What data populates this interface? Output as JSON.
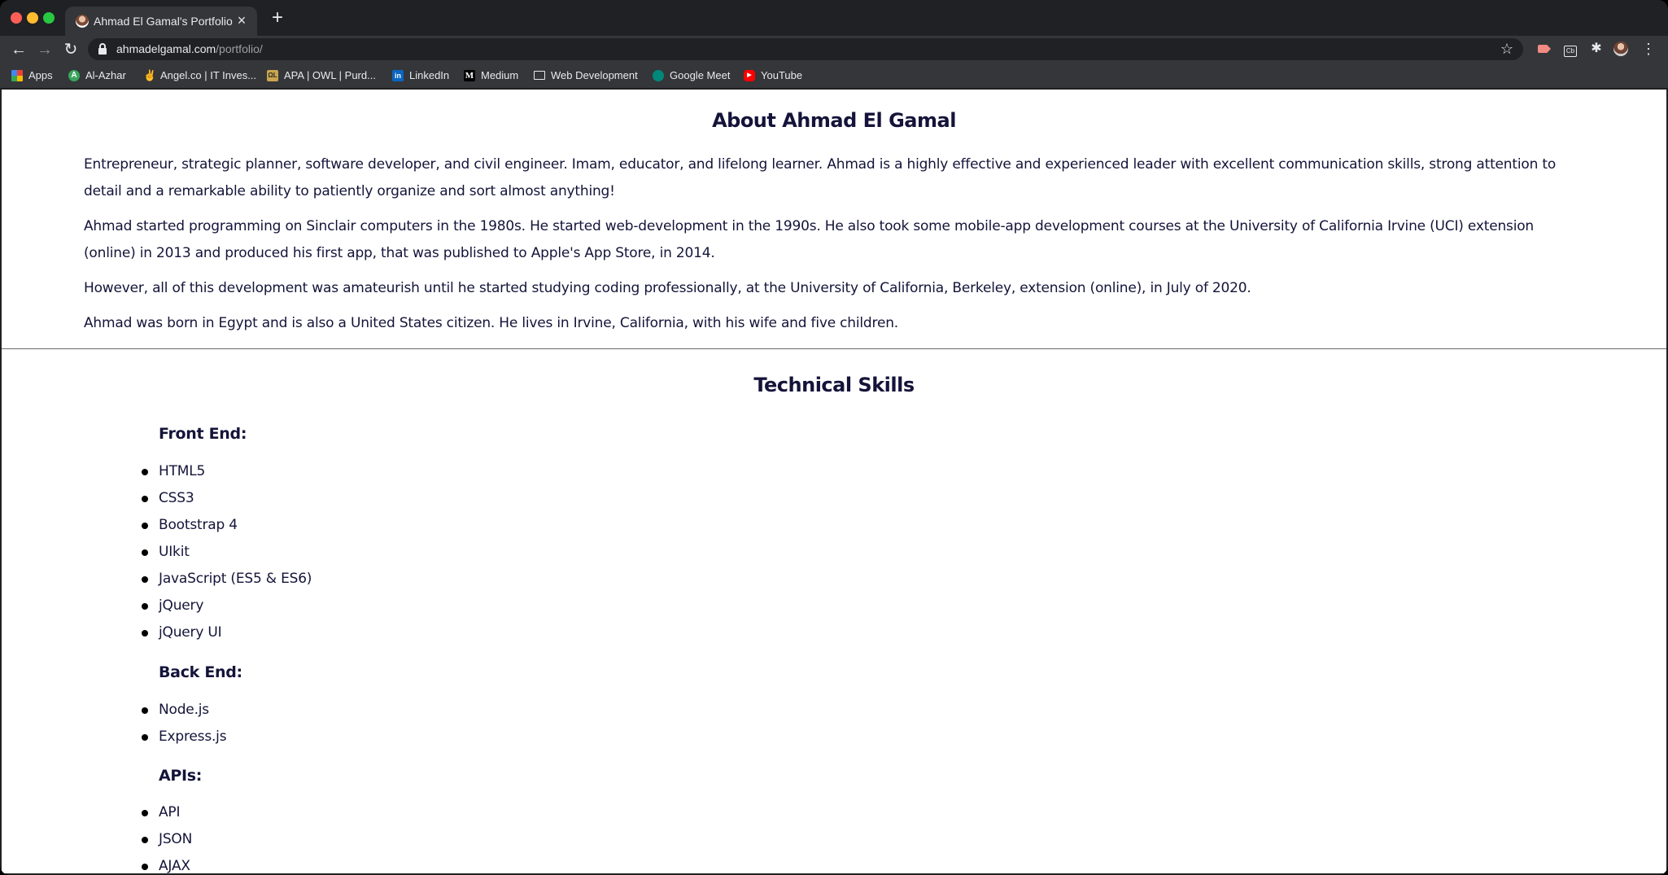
{
  "browser": {
    "tab_title": "Ahmad El Gamal's Portfolio",
    "tab_close": "×",
    "new_tab": "+",
    "url_host": "ahmadelgamal.com",
    "url_path": "/portfolio/",
    "bookmarks": [
      {
        "label": "Apps",
        "icon": "apps-grid-icon"
      },
      {
        "label": "Al-Azhar",
        "icon": "al-azhar-icon"
      },
      {
        "label": "Angel.co | IT Inves...",
        "icon": "angel-icon"
      },
      {
        "label": "APA | OWL | Purd...",
        "icon": "purdue-icon"
      },
      {
        "label": "LinkedIn",
        "icon": "linkedin-icon"
      },
      {
        "label": "Medium",
        "icon": "medium-icon"
      },
      {
        "label": "Web Development",
        "icon": "folder-icon"
      },
      {
        "label": "Google Meet",
        "icon": "google-meet-icon"
      },
      {
        "label": "YouTube",
        "icon": "youtube-icon"
      }
    ],
    "colors": {
      "chrome_dark": "#202124",
      "chrome_toolbar": "#35363a"
    }
  },
  "about": {
    "heading": "About Ahmad El Gamal",
    "paragraphs": [
      "Entrepreneur, strategic planner, software developer, and civil engineer. Imam, educator, and lifelong learner. Ahmad is a highly effective and experienced leader with excellent communication skills, strong attention to detail and a remarkable ability to patiently organize and sort almost anything!",
      "Ahmad started programming on Sinclair computers in the 1980s. He started web-development in the 1990s. He also took some mobile-app development courses at the University of California Irvine (UCI) extension (online) in 2013 and produced his first app, that was published to Apple's App Store, in 2014.",
      "However, all of this development was amateurish until he started studying coding professionally, at the University of California, Berkeley, extension (online), in July of 2020.",
      "Ahmad was born in Egypt and is also a United States citizen. He lives in Irvine, California, with his wife and five children."
    ]
  },
  "skills": {
    "heading": "Technical Skills",
    "front_end": {
      "title": "Front End:",
      "items": [
        "HTML5",
        "CSS3",
        "Bootstrap 4",
        "UIkit",
        "JavaScript (ES5 & ES6)",
        "jQuery",
        "jQuery UI"
      ]
    },
    "back_end": {
      "title": "Back End:",
      "items": [
        "Node.js",
        "Express.js"
      ]
    },
    "apis": {
      "title": "APIs:",
      "items": [
        "API",
        "JSON",
        "AJAX"
      ]
    }
  },
  "page_colors": {
    "text": "#14143a",
    "background": "#ffffff",
    "divider": "#6b6b6b"
  }
}
